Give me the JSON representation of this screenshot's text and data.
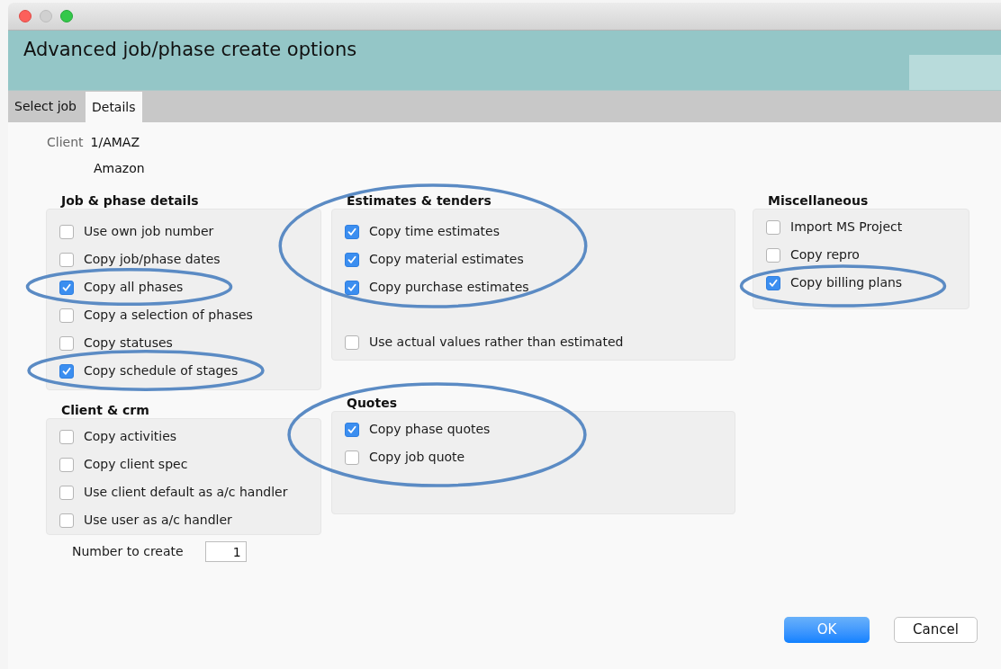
{
  "window": {
    "title": "Advanced job/phase create options"
  },
  "tabs": [
    {
      "label": "Select job",
      "selected": false
    },
    {
      "label": "Details",
      "selected": true
    }
  ],
  "client": {
    "label": "Client",
    "code": "1/AMAZ",
    "name": "Amazon"
  },
  "columns": [
    [
      {
        "title": "Job & phase details",
        "circled": false,
        "options": [
          {
            "label": "Use own job number",
            "checked": false,
            "circled": false
          },
          {
            "label": "Copy job/phase dates",
            "checked": false,
            "circled": false
          },
          {
            "label": "Copy all phases",
            "checked": true,
            "circled": true
          },
          {
            "label": "Copy a selection of phases",
            "checked": false,
            "circled": false
          },
          {
            "label": "Copy statuses",
            "checked": false,
            "circled": false
          },
          {
            "label": "Copy schedule of stages",
            "checked": true,
            "circled": true
          }
        ]
      },
      {
        "title": "Client & crm",
        "circled": false,
        "options": [
          {
            "label": "Copy activities",
            "checked": false,
            "circled": false
          },
          {
            "label": "Copy client spec",
            "checked": false,
            "circled": false
          },
          {
            "label": "Use client default as a/c handler",
            "checked": false,
            "circled": false
          },
          {
            "label": "Use user as a/c handler",
            "checked": false,
            "circled": false
          }
        ]
      }
    ],
    [
      {
        "title": "Estimates & tenders",
        "circled": true,
        "options": [
          {
            "label": "Copy time estimates",
            "checked": true,
            "circled": false
          },
          {
            "label": "Copy material estimates",
            "checked": true,
            "circled": false
          },
          {
            "label": "Copy purchase estimates",
            "checked": true,
            "circled": false
          },
          {
            "label": "Use actual values rather than estimated",
            "checked": false,
            "circled": false,
            "separated": true
          }
        ]
      },
      {
        "title": "Quotes",
        "circled": true,
        "options": [
          {
            "label": "Copy phase quotes",
            "checked": true,
            "circled": false
          },
          {
            "label": "Copy job quote",
            "checked": false,
            "circled": false
          }
        ]
      }
    ],
    [
      {
        "title": "Miscellaneous",
        "circled": false,
        "options": [
          {
            "label": "Import MS Project",
            "checked": false,
            "circled": false
          },
          {
            "label": "Copy repro",
            "checked": false,
            "circled": false
          },
          {
            "label": "Copy billing plans",
            "checked": true,
            "circled": true
          }
        ]
      }
    ]
  ],
  "number_to_create": {
    "label": "Number to create",
    "value": "1"
  },
  "buttons": [
    {
      "label": "OK",
      "kind": "default"
    },
    {
      "label": "Cancel",
      "kind": "normal"
    }
  ]
}
